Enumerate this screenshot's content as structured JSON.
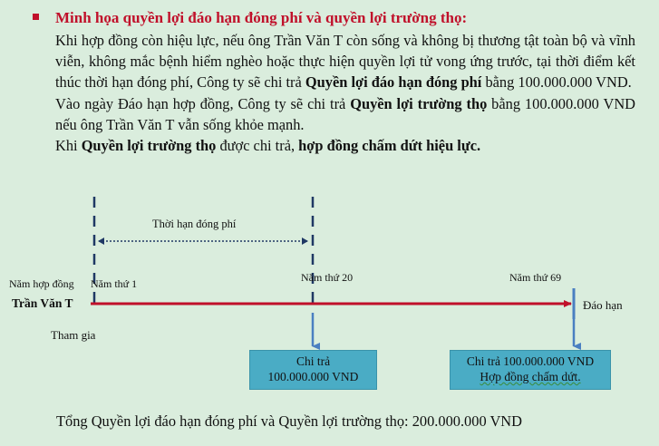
{
  "heading": "Minh họa quyền lợi đáo hạn đóng phí và quyền lợi trường thọ:",
  "para1": {
    "pre": "Khi hợp đồng còn hiệu lực, nếu ông Trần Văn T còn sống và không bị thương tật toàn bộ và vĩnh viễn, không mắc bệnh hiểm nghèo hoặc thực hiện quyền lợi tử vong ứng trước, tại thời điểm kết thúc thời hạn đóng phí, Công ty sẽ chi trả ",
    "bold": "Quyền lợi đáo hạn đóng phí",
    "post": " bằng 100.000.000 VND."
  },
  "para2": {
    "pre": "Vào ngày Đáo hạn hợp đồng, Công ty sẽ chi trả ",
    "bold": "Quyền lợi trường thọ",
    "post": " bằng 100.000.000 VND nếu ông Trần Văn T vẫn sống khỏe mạnh."
  },
  "para3": {
    "pre": "Khi ",
    "bold1": "Quyền lợi trường thọ",
    "mid": " được chi trả, ",
    "bold2": "hợp đồng chấm dứt hiệu lực."
  },
  "timeline": {
    "premium_period_label": "Thời hạn đóng phí",
    "contract_year_label": "Năm hợp đồng",
    "year1_label": "Năm thứ 1",
    "year20_label": "Năm thứ 20",
    "year69_label": "Năm thứ 69",
    "insured_name": "Trần Văn T",
    "join_label": "Tham gia",
    "maturity_label": "Đáo hạn",
    "colors": {
      "line": "#c0102a",
      "dash": "#1f3864",
      "arrow": "#4a7fc1",
      "box": "#4aacc5"
    }
  },
  "box1": {
    "line1": "Chi trả",
    "line2": "100.000.000 VND"
  },
  "box2": {
    "line1": "Chi trả 100.000.000 VND",
    "line2": "Hợp đồng chấm dứt."
  },
  "footer": "Tổng Quyền lợi đáo hạn đóng phí và Quyền lợi trường thọ: 200.000.000 VND"
}
